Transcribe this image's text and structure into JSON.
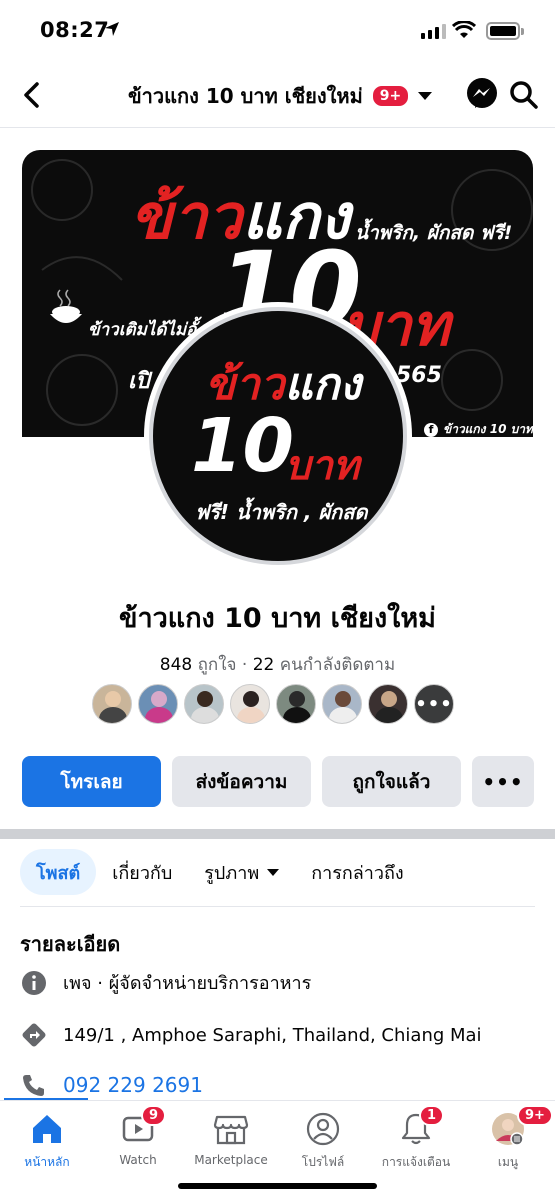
{
  "status": {
    "time": "08:27"
  },
  "header": {
    "title": "ข้าวแกง 10 บาท เชียงใหม่",
    "badge": "9+"
  },
  "cover": {
    "line1_red": "ข้าว",
    "line1_white": "แกง",
    "side_text": "น้ำพริก, ผักสด ฟรี!",
    "ten": "10",
    "baht": "บาท",
    "rice_text": "ข้าวเติมได้ไม่อั้",
    "open_text": "เปิ",
    "phone_fragment": "565",
    "fb_tag": "ข้าวแกง 10 บาท"
  },
  "profile_pic": {
    "line1_red": "ข้าว",
    "line1_white": "แกง",
    "ten": "10",
    "baht": "บาท",
    "free": "ฟรี! น้ำพริก , ผักสด"
  },
  "page": {
    "name": "ข้าวแกง 10 บาท เชียงใหม่",
    "likes": "848",
    "likes_label": "ถูกใจ",
    "dot": "·",
    "followers": "22",
    "followers_label": "คนกำลังติดตาม",
    "more_friends": "•••"
  },
  "actions": {
    "call": "โทรเลย",
    "message": "ส่งข้อความ",
    "liked": "ถูกใจแล้ว",
    "more": "•••"
  },
  "tabs": [
    {
      "label": "โพสต์"
    },
    {
      "label": "เกี่ยวกับ"
    },
    {
      "label": "รูปภาพ"
    },
    {
      "label": "การกล่าวถึง"
    }
  ],
  "details": {
    "title": "รายละเอียด",
    "category": "เพจ · ผู้จัดจำหน่ายบริการอาหาร",
    "address": "149/1 , Amphoe Saraphi, Thailand, Chiang Mai",
    "phone": "092 229 2691"
  },
  "bottom_nav": {
    "home": "หน้าหลัก",
    "watch": "Watch",
    "watch_badge": "9",
    "marketplace": "Marketplace",
    "profile": "โปรไฟล์",
    "notifications": "การแจ้งเตือน",
    "notifications_badge": "1",
    "menu": "เมนู",
    "menu_badge": "9+"
  },
  "colors": {
    "accent": "#1b74e4",
    "badge": "#e41e3f",
    "brand_red": "#e32222"
  },
  "icons": [
    "location-arrow-icon",
    "signal-icon",
    "wifi-icon",
    "battery-icon",
    "back-icon",
    "messenger-icon",
    "search-icon",
    "rice-bowl-icon",
    "facebook-icon",
    "info-icon",
    "directions-icon",
    "phone-icon",
    "home-icon",
    "watch-icon",
    "marketplace-icon",
    "profile-icon",
    "bell-icon",
    "menu-icon"
  ]
}
